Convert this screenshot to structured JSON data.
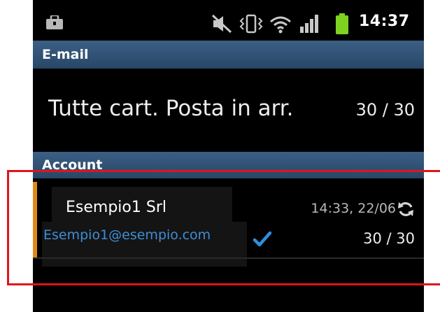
{
  "status_bar": {
    "time": "14:37",
    "icons": [
      "shopping-bag-icon",
      "mute-icon",
      "vibrate-icon",
      "wifi-icon",
      "signal-icon",
      "battery-icon"
    ],
    "battery_color": "#7ed321"
  },
  "email_section": {
    "header": "E-mail",
    "combined_inbox": {
      "label": "Tutte cart. Posta in arr.",
      "count": "30 / 30"
    }
  },
  "account_section": {
    "header": "Account",
    "accounts": [
      {
        "name": "Esempio1 Srl",
        "email": "Esempio1@esempio.com",
        "last_sync": "14:33, 22/06",
        "count": "30 / 30",
        "color": "#e08a1a",
        "default": true
      }
    ]
  },
  "colors": {
    "header_bg": "#3c5f85",
    "email_link": "#3d8fd6",
    "highlight": "#e3131b"
  }
}
